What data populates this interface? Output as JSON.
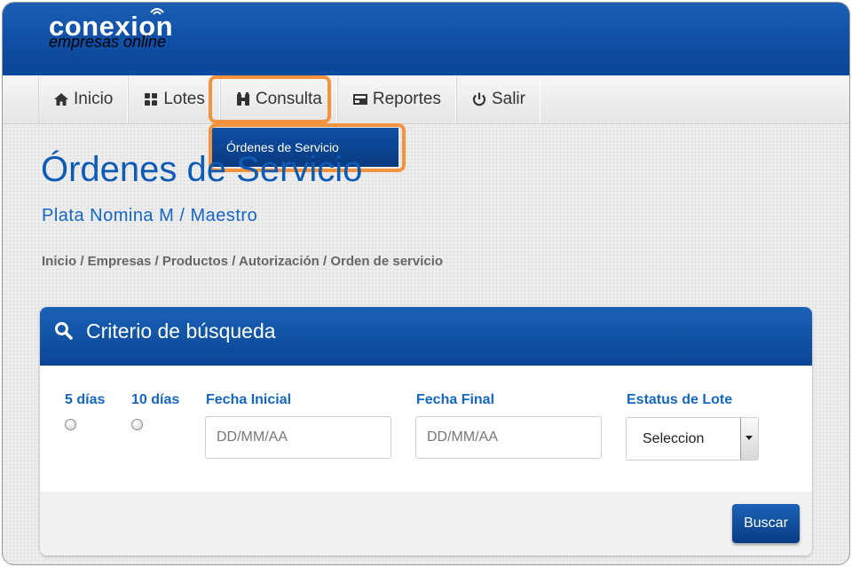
{
  "brand": {
    "name": "conexion",
    "tagline": "empresas online"
  },
  "nav": [
    {
      "label": "Inicio",
      "icon": "home-icon"
    },
    {
      "label": "Lotes",
      "icon": "puzzle-icon"
    },
    {
      "label": "Consulta",
      "icon": "binoculars-icon"
    },
    {
      "label": "Reportes",
      "icon": "report-icon"
    },
    {
      "label": "Salir",
      "icon": "power-icon"
    }
  ],
  "dropdown": {
    "item": "Órdenes de Servicio"
  },
  "page": {
    "title": "Órdenes de Servicio",
    "subtitle": "Plata Nomina M / Maestro",
    "breadcrumb": "Inicio / Empresas / Productos / Autorización / Orden de servicio"
  },
  "search": {
    "title": "Criterio de búsqueda",
    "five_days": "5 días",
    "ten_days": "10 días",
    "start_label": "Fecha Inicial",
    "start_placeholder": "DD/MM/AA",
    "end_label": "Fecha Final",
    "end_placeholder": "DD/MM/AA",
    "status_label": "Estatus de Lote",
    "status_value": "Seleccion",
    "button": "Buscar"
  },
  "colors": {
    "primary": "#0f4fa5",
    "accent_text": "#1466c4",
    "highlight": "#f5923e"
  }
}
